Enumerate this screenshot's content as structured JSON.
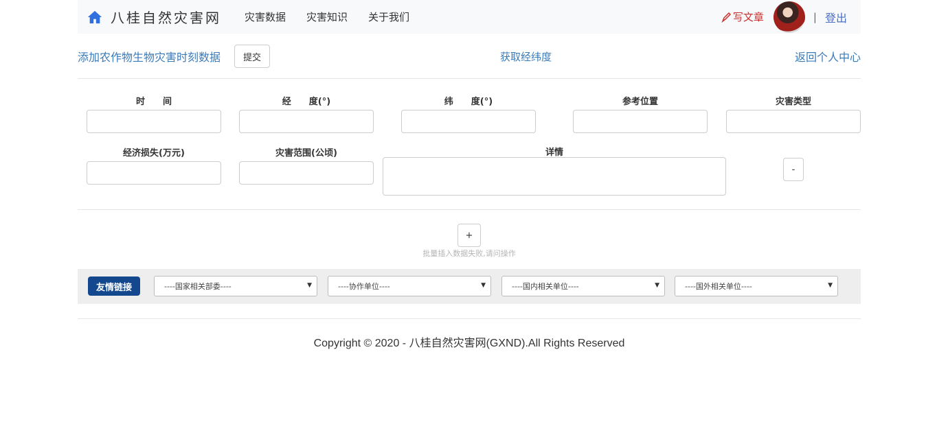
{
  "header": {
    "brand": "八桂自然灾害网",
    "nav": [
      "灾害数据",
      "灾害知识",
      "关于我们"
    ],
    "write_article": "写文章",
    "separator": "|",
    "logout": "登出"
  },
  "toolbar": {
    "title": "添加农作物生物灾害时刻数据",
    "submit": "提交",
    "get_coords": "获取经纬度",
    "back": "返回个人中心"
  },
  "form": {
    "labels": {
      "time": "时　　间",
      "longitude": "经　　度(°)",
      "latitude": "纬　　度(°)",
      "reference": "参考位置",
      "disaster_type": "灾害类型",
      "economic_loss": "经济损失(万元)",
      "disaster_range": "灾害范围(公顷)",
      "details": "详情"
    },
    "remove_button": "-",
    "add_button": "+",
    "hint": "批量插入数据失败,请问操作"
  },
  "links": {
    "friend_button": "友情链接",
    "selects": [
      "----国家相关部委----",
      "----协作单位----",
      "----国内相关单位----",
      "----国外相关单位----"
    ]
  },
  "footer": {
    "copyright": "Copyright © 2020 - 八桂自然灾害网(GXND).All Rights Reserved"
  },
  "colors": {
    "brand_blue": "#2f6fe0",
    "link_blue": "#3a7ab7",
    "write_red": "#c9302c",
    "friend_button_bg": "#14488e"
  },
  "icons": [
    "home-icon",
    "pen-icon",
    "avatar",
    "chevron-down-icon"
  ]
}
